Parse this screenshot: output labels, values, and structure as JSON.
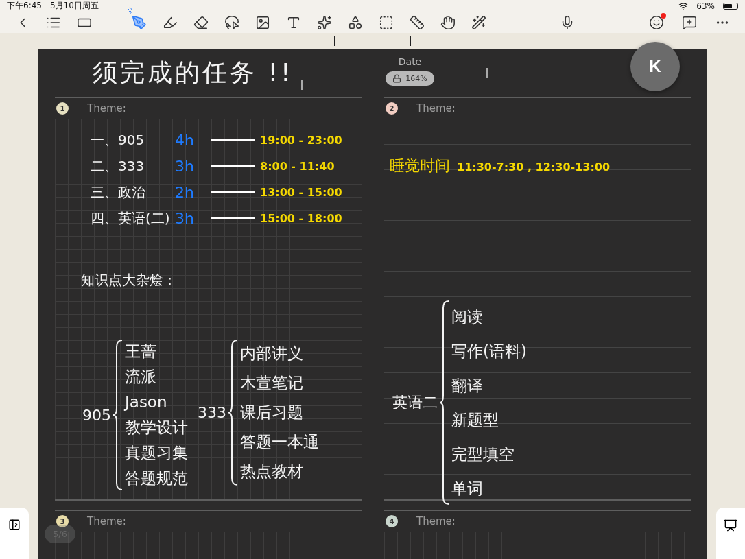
{
  "status_bar": {
    "time": "下午6:45",
    "date": "5月10日周五",
    "battery": "63%"
  },
  "toolbar": {
    "stylus_connected": true,
    "sticker_badge": true,
    "nav": [
      {
        "kind": "back"
      },
      {
        "kind": "outline"
      },
      {
        "kind": "textbox"
      }
    ],
    "tools": [
      {
        "kind": "pen",
        "selected": true
      },
      {
        "kind": "highlighter",
        "selected": false
      },
      {
        "kind": "eraser",
        "selected": false
      },
      {
        "kind": "lasso",
        "selected": false
      },
      {
        "kind": "image",
        "selected": false
      },
      {
        "kind": "text",
        "selected": false
      },
      {
        "kind": "elements",
        "selected": false
      },
      {
        "kind": "shapes",
        "selected": false
      },
      {
        "kind": "select",
        "selected": false
      },
      {
        "kind": "tape",
        "selected": false
      },
      {
        "kind": "hand",
        "selected": false
      },
      {
        "kind": "laser",
        "selected": false
      }
    ],
    "right": [
      {
        "kind": "mic"
      },
      {
        "kind": "sticker"
      },
      {
        "kind": "comment"
      },
      {
        "kind": "more"
      }
    ]
  },
  "page": {
    "k_button": "K",
    "title": "须完成的任务 !!",
    "date_label": "Date",
    "zoom": "164%",
    "page_indicator": "5/6",
    "sections": [
      {
        "number": "1",
        "color": "#e6e0c0",
        "theme_label": "Theme:",
        "kind": "grid",
        "tasks": [
          {
            "label": "一、905",
            "hours": "4h",
            "time": "19:00 - 23:00"
          },
          {
            "label": "二、333",
            "hours": "3h",
            "time": "8:00 - 11:40"
          },
          {
            "label": "三、政治",
            "hours": "2h",
            "time": "13:00 - 15:00"
          },
          {
            "label": "四、英语(二)",
            "hours": "3h",
            "time": "15:00 - 18:00"
          }
        ],
        "heading": "知识点大杂烩 :",
        "groups": [
          {
            "label": "905",
            "items": [
              "王蔷",
              "流派",
              "Jason",
              "教学设计",
              "真题习集",
              "答题规范"
            ]
          },
          {
            "label": "333",
            "items": [
              "内部讲义",
              "木萱笔记",
              "课后习题",
              "答题一本通",
              "热点教材"
            ]
          }
        ]
      },
      {
        "number": "2",
        "color": "#f2cdc2",
        "theme_label": "Theme:",
        "kind": "lined",
        "note_label": "睡觉时间",
        "note_times": "11:30-7:30 , 12:30-13:00",
        "groups": [
          {
            "label": "英语二",
            "items": [
              "阅读",
              "写作(语料)",
              "翻译",
              "新题型",
              "完型填空",
              "单词"
            ]
          }
        ]
      },
      {
        "number": "3",
        "color": "#e8dca8",
        "theme_label": "Theme:",
        "kind": "grid"
      },
      {
        "number": "4",
        "color": "#c9d6cd",
        "theme_label": "Theme:",
        "kind": "grid"
      }
    ]
  }
}
